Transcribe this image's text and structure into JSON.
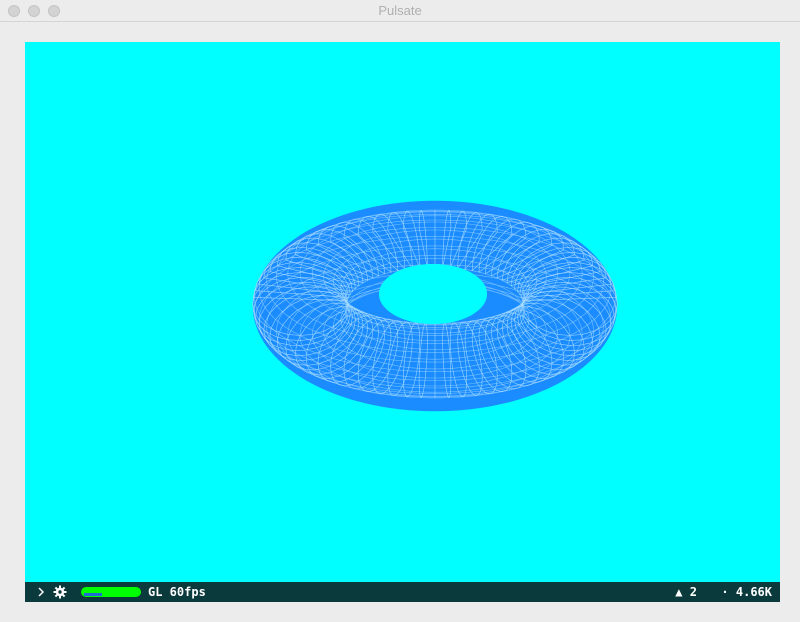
{
  "window": {
    "title": "Pulsate"
  },
  "viewport": {
    "background": "#00ffff",
    "object": "torus-wireframe",
    "object_color": "#1a8cff"
  },
  "statusbar": {
    "fps_label": "GL 60fps",
    "meter_level": 1.0,
    "triangle_glyph": "▲",
    "triangle_count": "2",
    "dot_glyph": "·",
    "point_count": "4.66K"
  }
}
